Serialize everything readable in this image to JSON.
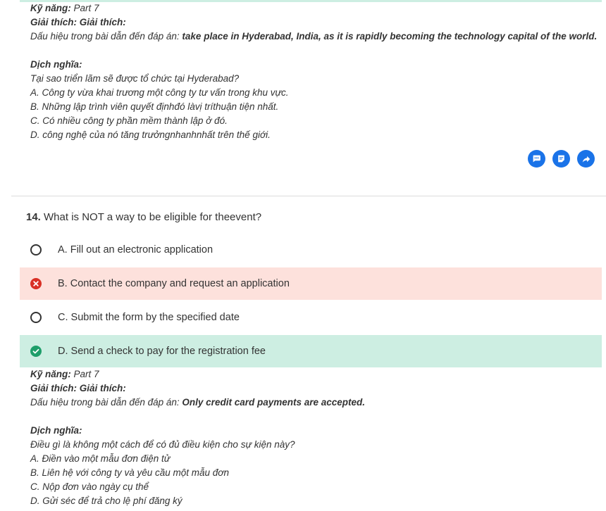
{
  "previous": {
    "skill": "Kỹ năng:",
    "skill_value": " Part 7",
    "explain_label": "Giải thích: Giải thích:",
    "evidence_prefix": "Dấu hiệu trong bài dẫn đến đáp án: ",
    "evidence": "take place in Hyderabad, India, as it is rapidly becoming the technology capital of the world.",
    "translation_label": "Dịch nghĩa:",
    "translation_lines": [
      "Tại sao triển lãm sẽ được tổ chức tại Hyderabad?",
      "A. Công ty vừa khai trương một công ty tư vấn trong khu vực.",
      "B. Những lập trình viên quyết địnhđó làvị tríthuận tiện nhất.",
      "C. Có nhiều công ty phần mềm thành lập ở đó.",
      "D. công nghệ của nó tăng trưởngnhanhnhất trên thế giới."
    ]
  },
  "actions": [
    {
      "icon": "comment-icon"
    },
    {
      "icon": "note-icon"
    },
    {
      "icon": "share-icon"
    }
  ],
  "question": {
    "number": "14.",
    "text": " What is NOT a way to be eligible for theevent?",
    "options": [
      {
        "label": "A. Fill out an electronic application",
        "state": "unselected"
      },
      {
        "label": "B. Contact the company and request an application",
        "state": "wrong"
      },
      {
        "label": "C. Submit the form by the specified date",
        "state": "unselected"
      },
      {
        "label": "D. Send a check to pay for the registration fee",
        "state": "correct"
      }
    ]
  },
  "current": {
    "skill": "Kỹ năng:",
    "skill_value": " Part 7",
    "explain_label": "Giải thích: Giải thích:",
    "evidence_prefix": "Dấu hiệu trong bài dẫn đến đáp án: ",
    "evidence": "Only credit card payments are accepted.",
    "translation_label": "Dịch nghĩa:",
    "translation_lines": [
      "Điều gì là không một cách để có đủ điều kiện cho sự kiện này?",
      "A. Điền vào một mẫu đơn điện tử",
      "B. Liên hệ với công ty và yêu cầu một mẫu đơn",
      "C. Nộp đơn vào ngày cụ thể",
      "D. Gửi séc để trả cho lệ phí đăng ký"
    ]
  },
  "colors": {
    "correct_bg": "#cdeee2",
    "wrong_bg": "#fde1dc",
    "correct_icon": "#1e9e6a",
    "wrong_icon": "#d93025",
    "action_blue": "#1a73e8"
  }
}
